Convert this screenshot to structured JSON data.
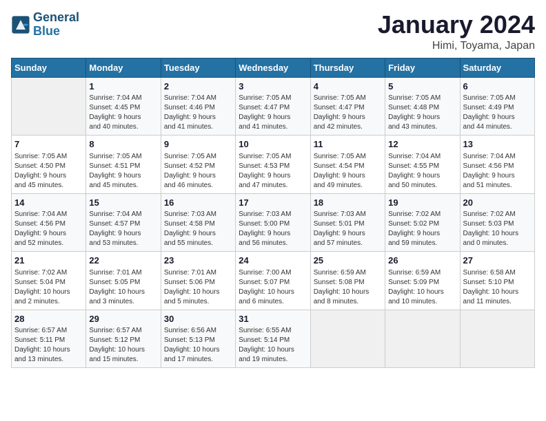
{
  "logo": {
    "text_general": "General",
    "text_blue": "Blue"
  },
  "header": {
    "title": "January 2024",
    "subtitle": "Himi, Toyama, Japan"
  },
  "days_of_week": [
    "Sunday",
    "Monday",
    "Tuesday",
    "Wednesday",
    "Thursday",
    "Friday",
    "Saturday"
  ],
  "weeks": [
    [
      {
        "day": "",
        "info": ""
      },
      {
        "day": "1",
        "info": "Sunrise: 7:04 AM\nSunset: 4:45 PM\nDaylight: 9 hours\nand 40 minutes."
      },
      {
        "day": "2",
        "info": "Sunrise: 7:04 AM\nSunset: 4:46 PM\nDaylight: 9 hours\nand 41 minutes."
      },
      {
        "day": "3",
        "info": "Sunrise: 7:05 AM\nSunset: 4:47 PM\nDaylight: 9 hours\nand 41 minutes."
      },
      {
        "day": "4",
        "info": "Sunrise: 7:05 AM\nSunset: 4:47 PM\nDaylight: 9 hours\nand 42 minutes."
      },
      {
        "day": "5",
        "info": "Sunrise: 7:05 AM\nSunset: 4:48 PM\nDaylight: 9 hours\nand 43 minutes."
      },
      {
        "day": "6",
        "info": "Sunrise: 7:05 AM\nSunset: 4:49 PM\nDaylight: 9 hours\nand 44 minutes."
      }
    ],
    [
      {
        "day": "7",
        "info": "Sunrise: 7:05 AM\nSunset: 4:50 PM\nDaylight: 9 hours\nand 45 minutes."
      },
      {
        "day": "8",
        "info": "Sunrise: 7:05 AM\nSunset: 4:51 PM\nDaylight: 9 hours\nand 45 minutes."
      },
      {
        "day": "9",
        "info": "Sunrise: 7:05 AM\nSunset: 4:52 PM\nDaylight: 9 hours\nand 46 minutes."
      },
      {
        "day": "10",
        "info": "Sunrise: 7:05 AM\nSunset: 4:53 PM\nDaylight: 9 hours\nand 47 minutes."
      },
      {
        "day": "11",
        "info": "Sunrise: 7:05 AM\nSunset: 4:54 PM\nDaylight: 9 hours\nand 49 minutes."
      },
      {
        "day": "12",
        "info": "Sunrise: 7:04 AM\nSunset: 4:55 PM\nDaylight: 9 hours\nand 50 minutes."
      },
      {
        "day": "13",
        "info": "Sunrise: 7:04 AM\nSunset: 4:56 PM\nDaylight: 9 hours\nand 51 minutes."
      }
    ],
    [
      {
        "day": "14",
        "info": "Sunrise: 7:04 AM\nSunset: 4:56 PM\nDaylight: 9 hours\nand 52 minutes."
      },
      {
        "day": "15",
        "info": "Sunrise: 7:04 AM\nSunset: 4:57 PM\nDaylight: 9 hours\nand 53 minutes."
      },
      {
        "day": "16",
        "info": "Sunrise: 7:03 AM\nSunset: 4:58 PM\nDaylight: 9 hours\nand 55 minutes."
      },
      {
        "day": "17",
        "info": "Sunrise: 7:03 AM\nSunset: 5:00 PM\nDaylight: 9 hours\nand 56 minutes."
      },
      {
        "day": "18",
        "info": "Sunrise: 7:03 AM\nSunset: 5:01 PM\nDaylight: 9 hours\nand 57 minutes."
      },
      {
        "day": "19",
        "info": "Sunrise: 7:02 AM\nSunset: 5:02 PM\nDaylight: 9 hours\nand 59 minutes."
      },
      {
        "day": "20",
        "info": "Sunrise: 7:02 AM\nSunset: 5:03 PM\nDaylight: 10 hours\nand 0 minutes."
      }
    ],
    [
      {
        "day": "21",
        "info": "Sunrise: 7:02 AM\nSunset: 5:04 PM\nDaylight: 10 hours\nand 2 minutes."
      },
      {
        "day": "22",
        "info": "Sunrise: 7:01 AM\nSunset: 5:05 PM\nDaylight: 10 hours\nand 3 minutes."
      },
      {
        "day": "23",
        "info": "Sunrise: 7:01 AM\nSunset: 5:06 PM\nDaylight: 10 hours\nand 5 minutes."
      },
      {
        "day": "24",
        "info": "Sunrise: 7:00 AM\nSunset: 5:07 PM\nDaylight: 10 hours\nand 6 minutes."
      },
      {
        "day": "25",
        "info": "Sunrise: 6:59 AM\nSunset: 5:08 PM\nDaylight: 10 hours\nand 8 minutes."
      },
      {
        "day": "26",
        "info": "Sunrise: 6:59 AM\nSunset: 5:09 PM\nDaylight: 10 hours\nand 10 minutes."
      },
      {
        "day": "27",
        "info": "Sunrise: 6:58 AM\nSunset: 5:10 PM\nDaylight: 10 hours\nand 11 minutes."
      }
    ],
    [
      {
        "day": "28",
        "info": "Sunrise: 6:57 AM\nSunset: 5:11 PM\nDaylight: 10 hours\nand 13 minutes."
      },
      {
        "day": "29",
        "info": "Sunrise: 6:57 AM\nSunset: 5:12 PM\nDaylight: 10 hours\nand 15 minutes."
      },
      {
        "day": "30",
        "info": "Sunrise: 6:56 AM\nSunset: 5:13 PM\nDaylight: 10 hours\nand 17 minutes."
      },
      {
        "day": "31",
        "info": "Sunrise: 6:55 AM\nSunset: 5:14 PM\nDaylight: 10 hours\nand 19 minutes."
      },
      {
        "day": "",
        "info": ""
      },
      {
        "day": "",
        "info": ""
      },
      {
        "day": "",
        "info": ""
      }
    ]
  ]
}
